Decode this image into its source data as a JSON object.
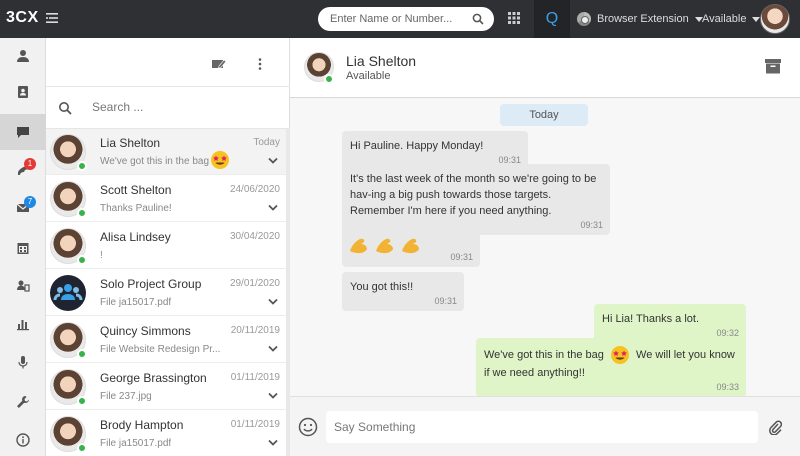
{
  "topbar": {
    "logo": "3CX",
    "search_placeholder": "Enter Name or Number...",
    "q_label": "Q",
    "extension_label": "Browser Extension",
    "status_label": "Available"
  },
  "nav": {
    "items": [
      {
        "name": "contacts",
        "icon": "person-icon"
      },
      {
        "name": "phonebook",
        "icon": "address-book-icon"
      },
      {
        "name": "chat",
        "icon": "chat-bubble-icon",
        "active": true
      },
      {
        "name": "calls",
        "icon": "phone-icon",
        "badge": "1"
      },
      {
        "name": "voicemail",
        "icon": "envelope-icon",
        "badge": "7"
      },
      {
        "name": "calendar",
        "icon": "calendar-icon"
      },
      {
        "name": "switchboard",
        "icon": "switchboard-icon"
      },
      {
        "name": "reports",
        "icon": "bar-chart-icon"
      },
      {
        "name": "recordings",
        "icon": "microphone-icon"
      },
      {
        "name": "settings",
        "icon": "wrench-icon"
      },
      {
        "name": "about",
        "icon": "info-icon"
      }
    ]
  },
  "list": {
    "search_placeholder": "Search ...",
    "conversations": [
      {
        "name": "Lia Shelton",
        "date": "Today",
        "preview": "We've got this in the bag",
        "has_emoji": true,
        "online": true,
        "group": false
      },
      {
        "name": "Scott Shelton",
        "date": "24/06/2020",
        "preview": "Thanks Pauline!",
        "online": true,
        "group": false
      },
      {
        "name": "Alisa Lindsey",
        "date": "30/04/2020",
        "preview": "!",
        "online": true,
        "group": false
      },
      {
        "name": "Solo Project Group",
        "date": "29/01/2020",
        "preview": "File ja15017.pdf",
        "online": false,
        "group": true
      },
      {
        "name": "Quincy Simmons",
        "date": "20/11/2019",
        "preview": "File Website Redesign Pr...",
        "online": true,
        "group": false
      },
      {
        "name": "George Brassington",
        "date": "01/11/2019",
        "preview": "File 237.jpg",
        "online": true,
        "group": false
      },
      {
        "name": "Brody Hampton",
        "date": "01/11/2019",
        "preview": "File ja15017.pdf",
        "online": true,
        "group": false
      }
    ]
  },
  "chat": {
    "contact_name": "Lia Shelton",
    "contact_status": "Available",
    "day_label": "Today",
    "messages": [
      {
        "direction": "in",
        "text": "Hi Pauline. Happy Monday!",
        "time": "09:31"
      },
      {
        "direction": "in",
        "text": "It's the last week of the month so we're going to be hav-ing a big push towards those targets. Remember I'm here if you need anything.",
        "time": "09:31"
      },
      {
        "direction": "in",
        "text": "",
        "emoji": "muscle-emoji",
        "time": "09:31"
      },
      {
        "direction": "in",
        "text": "You got this!!",
        "time": "09:31"
      },
      {
        "direction": "out",
        "text": "Hi Lia! Thanks a lot.",
        "time": "09:32"
      },
      {
        "direction": "out",
        "text_before": "We've got this in the bag",
        "text_after": "We will let you know if we need anything!!",
        "time": "09:33"
      }
    ],
    "compose_placeholder": "Say Something"
  },
  "colors": {
    "topbar_bg": "#2f3034",
    "accent_blue": "#3aa0e6",
    "online_green": "#38b24a",
    "outgoing_bubble": "#dff5c8",
    "incoming_bubble": "#e8e8e8",
    "day_pill": "#dcebf6"
  }
}
